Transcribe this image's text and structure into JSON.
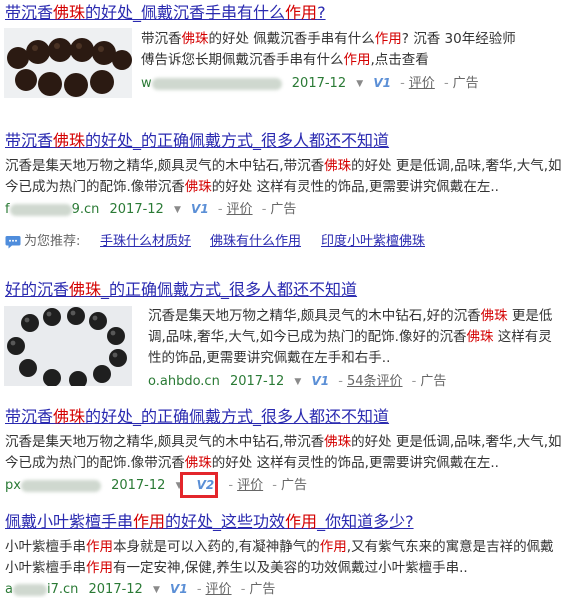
{
  "results": [
    {
      "title_parts": [
        {
          "text": "带沉香",
          "hl": false
        },
        {
          "text": "佛珠",
          "hl": true
        },
        {
          "text": "的好处_佩戴沉香手串有什么",
          "hl": false
        },
        {
          "text": "作用",
          "hl": true
        },
        {
          "text": "?",
          "hl": false
        }
      ],
      "abstract_lines": [
        [
          {
            "text": "带沉香",
            "hl": false
          },
          {
            "text": "佛珠",
            "hl": true
          },
          {
            "text": "的好处 佩戴沉香手串有什么",
            "hl": false
          },
          {
            "text": "作用",
            "hl": true
          },
          {
            "text": "?",
            "hl": false
          },
          {
            "text": "  沉香 30年经验师",
            "hl": false
          }
        ],
        [
          {
            "text": "傅告诉您长期佩戴沉香手串有什么",
            "hl": false
          },
          {
            "text": "作用",
            "hl": true
          },
          {
            "text": ",点击查看",
            "hl": false
          }
        ]
      ],
      "meta": {
        "domain": "w",
        "date": "2017-12",
        "v": "V1",
        "review": "评价",
        "ad": "广告"
      }
    },
    {
      "title_parts": [
        {
          "text": "带沉香",
          "hl": false
        },
        {
          "text": "佛珠",
          "hl": true
        },
        {
          "text": "的好处_的正确佩戴方式_很多人都还不知道",
          "hl": false
        }
      ],
      "abstract_lines": [
        [
          {
            "text": "沉香是集天地万物之精华,颇具灵气的木中钻石,带沉香",
            "hl": false
          },
          {
            "text": "佛珠",
            "hl": true
          },
          {
            "text": "的好处 更是低调,品味,奢华,大气,如",
            "hl": false
          }
        ],
        [
          {
            "text": "今已成为热门的配饰.像带沉香",
            "hl": false
          },
          {
            "text": "佛珠",
            "hl": true
          },
          {
            "text": "的好处 这样有灵性的饰品,更需要讲究佩戴在左..",
            "hl": false
          }
        ]
      ],
      "meta": {
        "domain": "f",
        "domain_tail": "9.cn",
        "date": "2017-12",
        "v": "V1",
        "review": "评价",
        "ad": "广告"
      }
    },
    {
      "title_parts": [
        {
          "text": "好的沉香",
          "hl": false
        },
        {
          "text": "佛珠",
          "hl": true
        },
        {
          "text": "_的正确佩戴方式_很多人都还不知道",
          "hl": false
        }
      ],
      "abstract_lines": [
        [
          {
            "text": "沉香是集天地万物之精华,颇具灵气的木中钻石,好的沉香",
            "hl": false
          },
          {
            "text": "佛珠",
            "hl": true
          },
          {
            "text": " 更是低",
            "hl": false
          }
        ],
        [
          {
            "text": "调,品味,奢华,大气,如今已成为热门的配饰.像好的沉香",
            "hl": false
          },
          {
            "text": "佛珠",
            "hl": true
          },
          {
            "text": " 这样有灵",
            "hl": false
          }
        ],
        [
          {
            "text": "性的饰品,更需要讲究佩戴在左手和右手..",
            "hl": false
          }
        ]
      ],
      "meta": {
        "domain": "o.ahbdo.cn",
        "date": "2017-12",
        "v": "V1",
        "review": "54条评价",
        "ad": "广告"
      }
    },
    {
      "title_parts": [
        {
          "text": "带沉香",
          "hl": false
        },
        {
          "text": "佛珠",
          "hl": true
        },
        {
          "text": "的好处_的正确佩戴方式_很多人都还不知道",
          "hl": false
        }
      ],
      "abstract_lines": [
        [
          {
            "text": "沉香是集天地万物之精华,颇具灵气的木中钻石,带沉香",
            "hl": false
          },
          {
            "text": "佛珠",
            "hl": true
          },
          {
            "text": "的好处 更是低调,品味,奢华,大气,如",
            "hl": false
          }
        ],
        [
          {
            "text": "今已成为热门的配饰.像带沉香",
            "hl": false
          },
          {
            "text": "佛珠",
            "hl": true
          },
          {
            "text": "的好处 这样有灵性的饰品,更需要讲究佩戴在左..",
            "hl": false
          }
        ]
      ],
      "meta": {
        "domain": "px",
        "date": "2017-12",
        "v": "V2",
        "review": "评价",
        "ad": "广告"
      }
    },
    {
      "title_parts": [
        {
          "text": "佩戴小叶紫檀手串",
          "hl": false
        },
        {
          "text": "作用",
          "hl": true
        },
        {
          "text": "的好处_这些功效",
          "hl": false
        },
        {
          "text": "作用",
          "hl": true
        },
        {
          "text": "_你知道多少?",
          "hl": false
        }
      ],
      "abstract_lines": [
        [
          {
            "text": "小叶紫檀手串",
            "hl": false
          },
          {
            "text": "作用",
            "hl": true
          },
          {
            "text": "本身就是可以入药的,有凝神静气的",
            "hl": false
          },
          {
            "text": "作用",
            "hl": true
          },
          {
            "text": ",又有紫气东来的寓意是吉祥的佩戴",
            "hl": false
          }
        ],
        [
          {
            "text": "小叶紫檀手串",
            "hl": false
          },
          {
            "text": "作用",
            "hl": true
          },
          {
            "text": "有一定安神,保健,养生以及美容的功效佩戴过小叶紫檀手串..",
            "hl": false
          }
        ]
      ],
      "meta": {
        "domain": "a",
        "domain_tail": "i7.cn",
        "date": "2017-12",
        "v": "V1",
        "review": "评价",
        "ad": "广告"
      }
    }
  ],
  "recommend": {
    "label": "为您推荐:",
    "items": [
      "手珠什么材质好",
      "佛珠有什么作用",
      "印度小叶紫檀佛珠"
    ]
  },
  "colors": {
    "link": "#2a2ab0",
    "highlight": "#d40000",
    "url_green": "#2a7a35",
    "v_blue": "#5b8fd6",
    "annotation_red": "#e3262b"
  }
}
